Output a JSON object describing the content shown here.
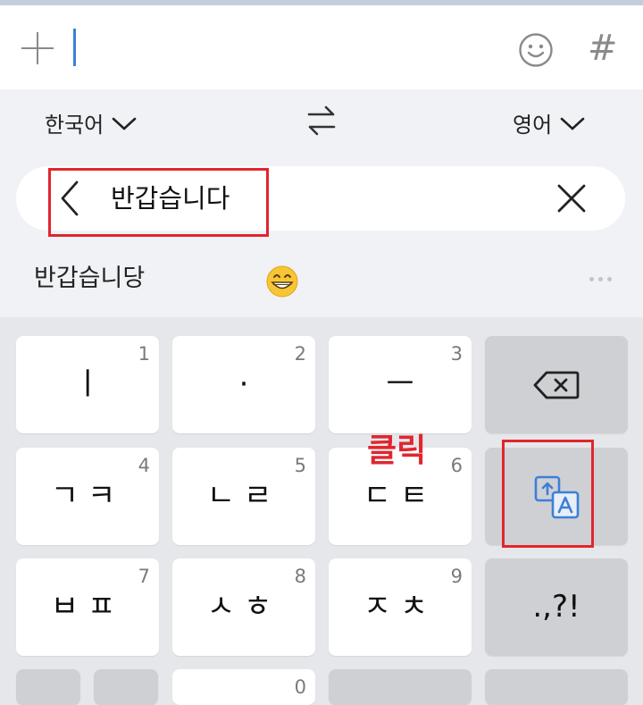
{
  "input_bar": {
    "plus_icon": "plus-icon",
    "emoji_icon": "smiley-face-icon",
    "hash_label": "#"
  },
  "translator": {
    "source_language": "한국어",
    "target_language": "영어",
    "swap_icon": "swap-arrows-icon",
    "input_text": "반갑습니다",
    "back_icon": "chevron-left-icon",
    "clear_icon": "close-icon"
  },
  "suggestions": {
    "word": "반갑습니당",
    "emoji": "grinning-face-emoji",
    "more_icon": "more-dots-icon"
  },
  "keyboard": {
    "rows": [
      [
        {
          "label": "ㅣ",
          "num": "1"
        },
        {
          "label": "·",
          "num": "2"
        },
        {
          "label": "ㅡ",
          "num": "3"
        },
        {
          "label": "",
          "num": "",
          "icon": "backspace-icon"
        }
      ],
      [
        {
          "label": "ㄱㅋ",
          "num": "4"
        },
        {
          "label": "ㄴㄹ",
          "num": "5"
        },
        {
          "label": "ㄷㅌ",
          "num": "6"
        },
        {
          "label": "",
          "num": "",
          "icon": "translate-icon"
        }
      ],
      [
        {
          "label": "ㅂㅍ",
          "num": "7"
        },
        {
          "label": "ㅅㅎ",
          "num": "8"
        },
        {
          "label": "ㅈㅊ",
          "num": "9"
        },
        {
          "label": ".,?!",
          "num": ""
        }
      ]
    ],
    "bottom_row_partial_num": "0"
  },
  "annotation": {
    "click_label": "클릭",
    "highlight_color": "#e0262e"
  },
  "colors": {
    "accent": "#3d7fd6",
    "translate_icon": "#3b7fd8"
  }
}
